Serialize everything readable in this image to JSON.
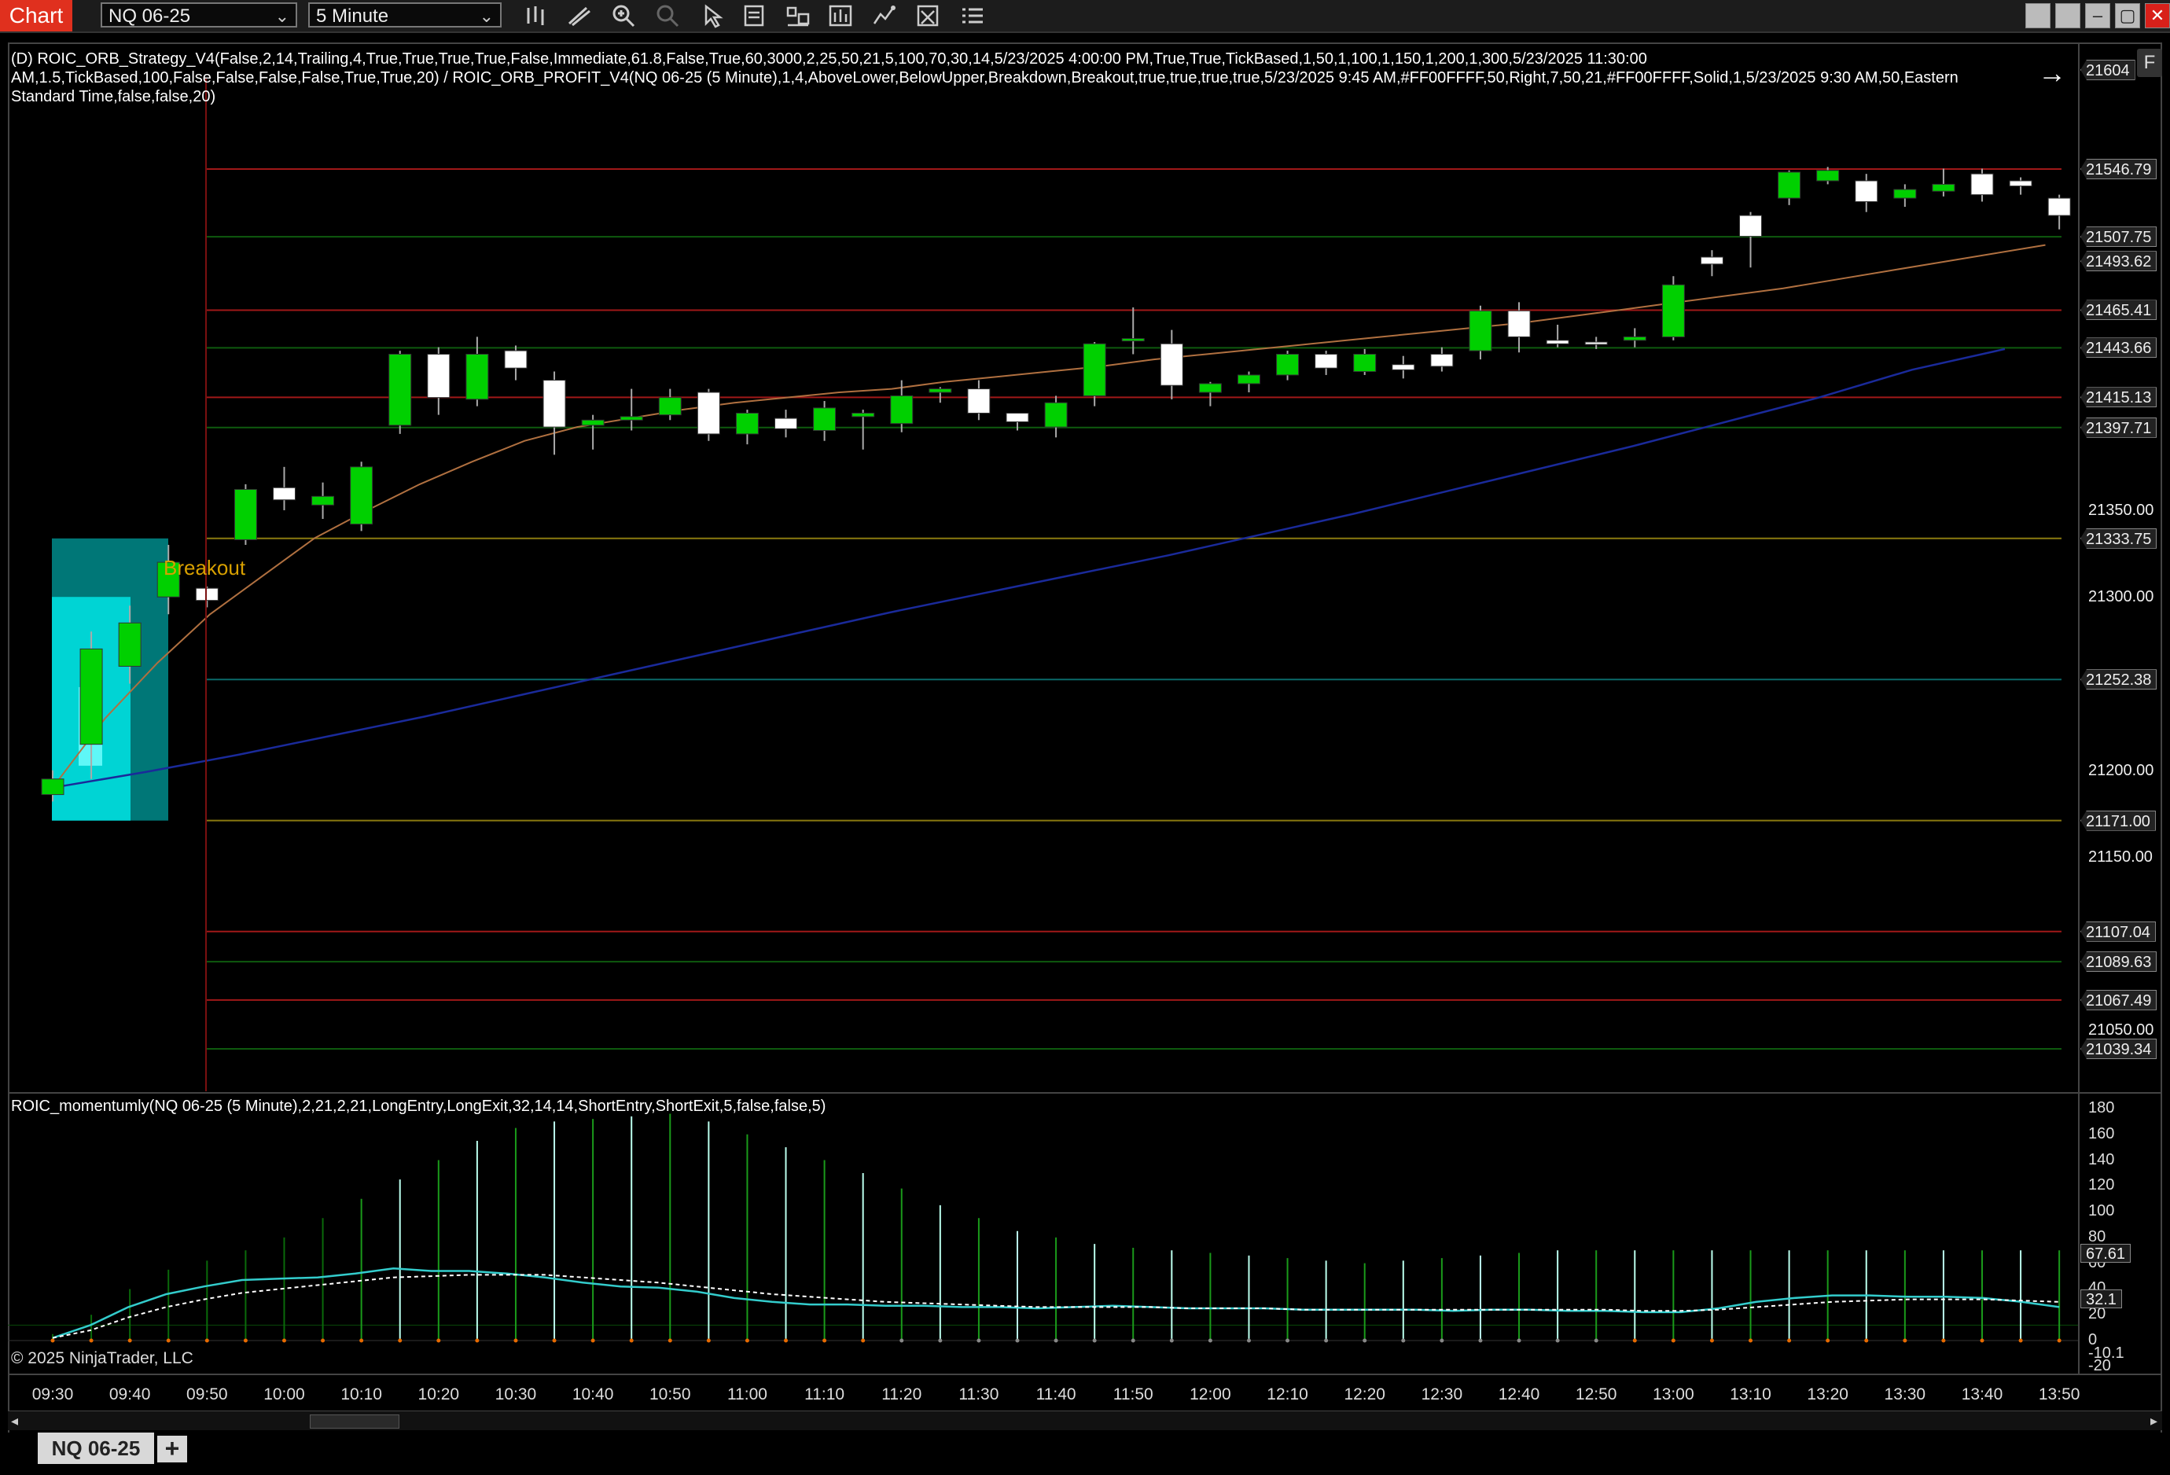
{
  "toolbar": {
    "chart_label": "Chart",
    "instrument": "NQ 06-25",
    "interval": "5 Minute",
    "icons": [
      "bars-type-icon",
      "draw-tool-icon",
      "zoom-in-icon",
      "zoom-out-icon",
      "pointer-icon",
      "data-box-icon",
      "strategies-icon",
      "indicators-icon",
      "chart-trader-icon",
      "templates-icon",
      "properties-icon"
    ],
    "window_buttons": [
      "minimize-icon",
      "restore-icon",
      "close-icon"
    ]
  },
  "panel_top": {
    "strategy_signature_line1": "(D) ROIC_ORB_Strategy_V4(False,2,14,Trailing,4,True,True,True,True,False,Immediate,61.8,False,True,60,3000,2,25,50,21,5,100,70,30,14,5/23/2025 4:00:00 PM,True,True,TickBased,1,50,1,100,1,150,1,200,1,300,5/23/2025 11:30:00",
    "strategy_signature_line2": "AM,1.5,TickBased,100,False,False,False,False,True,True,20) / ROIC_ORB_PROFIT_V4(NQ 06-25 (5 Minute),1,4,AboveLower,BelowUpper,Breakdown,Breakout,true,true,true,true,5/23/2025 9:45 AM,#FF00FFFF,50,Right,7,50,21,#FF00FFFF,Solid,1,5/23/2025 9:30 AM,50,Eastern",
    "strategy_signature_line3": "Standard Time,false,false,20)",
    "breakout_label": "Breakout",
    "f_badge": "F"
  },
  "price_scale": {
    "tags": [
      "21604",
      "21546.79",
      "21507.75",
      "21493.62",
      "21465.41",
      "21443.66",
      "21415.13",
      "21397.71",
      "21333.75",
      "21252.38",
      "21171.00",
      "21107.04",
      "21089.63",
      "21067.49",
      "21039.34"
    ],
    "plain_labels": [
      "21350.00",
      "21300.00",
      "21200.00",
      "21150.00",
      "21050.00"
    ]
  },
  "indicator": {
    "signature": "ROIC_momentumly(NQ 06-25 (5 Minute),2,21,2,21,LongEntry,LongExit,32,14,14,ShortEntry,ShortExit,5,false,false,5)",
    "scale_labels": [
      "180",
      "160",
      "140",
      "120",
      "100",
      "80",
      "60",
      "40",
      "20",
      "0",
      "-10.1",
      "-20"
    ],
    "value_tags": [
      "67.61",
      "32.1"
    ]
  },
  "time_axis": [
    "09:30",
    "09:40",
    "09:50",
    "10:00",
    "10:10",
    "10:20",
    "10:30",
    "10:40",
    "10:50",
    "11:00",
    "11:10",
    "11:20",
    "11:30",
    "11:40",
    "11:50",
    "12:00",
    "12:10",
    "12:20",
    "12:30",
    "12:40",
    "12:50",
    "13:00",
    "13:10",
    "13:20",
    "13:30",
    "13:40",
    "13:50"
  ],
  "copyright": "© 2025 NinjaTrader, LLC",
  "tabs": {
    "active": "NQ 06-25",
    "add": "+"
  },
  "colors": {
    "up": "#00d000",
    "down": "#ffffff",
    "ema_fast": "#b07040",
    "ema_slow": "#1a2a9a",
    "orb_box": "#00d8d8",
    "red_line": "#a01818",
    "green_line": "#0e5a0e",
    "yellow_line": "#8a7a10",
    "cyan_line": "#0a6a6a"
  },
  "chart_data": {
    "type": "candlestick",
    "symbol": "NQ 06-25",
    "interval": "5 Minute",
    "x": [
      "09:30",
      "09:35",
      "09:40",
      "09:45",
      "09:50",
      "09:55",
      "10:00",
      "10:05",
      "10:10",
      "10:15",
      "10:20",
      "10:25",
      "10:30",
      "10:35",
      "10:40",
      "10:45",
      "10:50",
      "10:55",
      "11:00",
      "11:05",
      "11:10",
      "11:15",
      "11:20",
      "11:25",
      "11:30",
      "11:35",
      "11:40",
      "11:45",
      "11:50",
      "11:55",
      "12:00",
      "12:05",
      "12:10",
      "12:15",
      "12:20",
      "12:25",
      "12:30",
      "12:35",
      "12:40",
      "12:45",
      "12:50",
      "12:55",
      "13:00",
      "13:05",
      "13:10",
      "13:15",
      "13:20",
      "13:25",
      "13:30",
      "13:35",
      "13:40",
      "13:45",
      "13:50"
    ],
    "ohlc": [
      [
        21186,
        21200,
        21182,
        21195
      ],
      [
        21215,
        21280,
        21195,
        21270
      ],
      [
        21260,
        21295,
        21250,
        21285
      ],
      [
        21300,
        21330,
        21290,
        21320
      ],
      [
        21305,
        21306,
        21294,
        21298
      ],
      [
        21333,
        21365,
        21330,
        21362
      ],
      [
        21363,
        21375,
        21350,
        21356
      ],
      [
        21353,
        21366,
        21345,
        21358
      ],
      [
        21342,
        21378,
        21338,
        21375
      ],
      [
        21399,
        21442,
        21394,
        21440
      ],
      [
        21440,
        21444,
        21405,
        21415
      ],
      [
        21414,
        21450,
        21410,
        21440
      ],
      [
        21442,
        21445,
        21425,
        21432
      ],
      [
        21425,
        21430,
        21382,
        21398
      ],
      [
        21399,
        21405,
        21385,
        21402
      ],
      [
        21402,
        21420,
        21396,
        21404
      ],
      [
        21405,
        21420,
        21402,
        21415
      ],
      [
        21418,
        21420,
        21390,
        21394
      ],
      [
        21394,
        21408,
        21388,
        21406
      ],
      [
        21403,
        21408,
        21392,
        21397
      ],
      [
        21396,
        21413,
        21390,
        21409
      ],
      [
        21404,
        21408,
        21385,
        21406
      ],
      [
        21400,
        21425,
        21395,
        21416
      ],
      [
        21418,
        21421,
        21412,
        21420
      ],
      [
        21420,
        21425,
        21402,
        21406
      ],
      [
        21406,
        21405,
        21396,
        21401
      ],
      [
        21398,
        21416,
        21392,
        21412
      ],
      [
        21416,
        21447,
        21410,
        21446
      ],
      [
        21448,
        21467,
        21440,
        21449
      ],
      [
        21446,
        21454,
        21414,
        21422
      ],
      [
        21418,
        21424,
        21410,
        21423
      ],
      [
        21423,
        21430,
        21418,
        21428
      ],
      [
        21428,
        21442,
        21425,
        21440
      ],
      [
        21440,
        21442,
        21428,
        21432
      ],
      [
        21430,
        21443,
        21428,
        21440
      ],
      [
        21434,
        21439,
        21426,
        21431
      ],
      [
        21440,
        21444,
        21430,
        21433
      ],
      [
        21442,
        21468,
        21437,
        21465
      ],
      [
        21465,
        21470,
        21441,
        21450
      ],
      [
        21448,
        21457,
        21444,
        21446
      ],
      [
        21447,
        21450,
        21443,
        21446
      ],
      [
        21448,
        21455,
        21444,
        21450
      ],
      [
        21450,
        21485,
        21448,
        21480
      ],
      [
        21496,
        21500,
        21485,
        21492
      ],
      [
        21520,
        21522,
        21490,
        21508
      ],
      [
        21530,
        21546,
        21526,
        21545
      ],
      [
        21540,
        21548,
        21538,
        21546
      ],
      [
        21540,
        21544,
        21522,
        21528
      ],
      [
        21530,
        21538,
        21525,
        21535
      ],
      [
        21534,
        21547,
        21531,
        21538
      ],
      [
        21544,
        21547,
        21528,
        21532
      ],
      [
        21540,
        21542,
        21532,
        21537
      ],
      [
        21530,
        21532,
        21512,
        21520
      ]
    ],
    "ema_fast": [
      21190,
      21230,
      21262,
      21290,
      21312,
      21334,
      21350,
      21365,
      21378,
      21390,
      21398,
      21403,
      21408,
      21412,
      21415,
      21418,
      21420,
      21424,
      21427,
      21430,
      21433,
      21437,
      21440,
      21443,
      21446,
      21449,
      21452,
      21455,
      21458,
      21462,
      21466,
      21470,
      21474,
      21478,
      21483,
      21488,
      21493,
      21498,
      21503
    ],
    "ema_slow": [
      21190,
      21199,
      21209,
      21220,
      21231,
      21243,
      21255,
      21267,
      21279,
      21291,
      21302,
      21313,
      21324,
      21336,
      21348,
      21361,
      21374,
      21387,
      21401,
      21415,
      21431,
      21443
    ],
    "levels": [
      {
        "value": 21546.79,
        "color": "red"
      },
      {
        "value": 21507.75,
        "color": "green"
      },
      {
        "value": 21465.41,
        "color": "red"
      },
      {
        "value": 21443.66,
        "color": "green"
      },
      {
        "value": 21415.13,
        "color": "red"
      },
      {
        "value": 21397.71,
        "color": "green"
      },
      {
        "value": 21333.75,
        "color": "yellow"
      },
      {
        "value": 21252.38,
        "color": "cyan"
      },
      {
        "value": 21171.0,
        "color": "yellow"
      },
      {
        "value": 21107.04,
        "color": "red"
      },
      {
        "value": 21089.63,
        "color": "green"
      },
      {
        "value": 21067.49,
        "color": "red"
      },
      {
        "value": 21039.34,
        "color": "green"
      }
    ],
    "orb_box": {
      "high": 21333.75,
      "low": 21171.0
    },
    "ylim": [
      21010,
      21625
    ],
    "momentum": {
      "ylim": [
        -22,
        185
      ],
      "bars": [
        5,
        20,
        40,
        55,
        62,
        70,
        80,
        95,
        110,
        125,
        140,
        155,
        165,
        170,
        172,
        174,
        176,
        170,
        160,
        150,
        140,
        130,
        118,
        105,
        95,
        85,
        80,
        75,
        72,
        70,
        68,
        66,
        64,
        62,
        60,
        62,
        64,
        66,
        68,
        70,
        70,
        70,
        70,
        70,
        70,
        70,
        70,
        70,
        70,
        70,
        70,
        70,
        70
      ],
      "line": [
        2,
        12,
        26,
        36,
        42,
        47,
        48,
        49,
        52,
        56,
        54,
        54,
        52,
        49,
        45,
        42,
        41,
        38,
        33,
        30,
        28,
        28,
        27,
        27,
        26,
        26,
        25,
        26,
        27,
        26,
        25,
        25,
        25,
        24,
        24,
        24,
        24,
        23,
        24,
        24,
        23,
        23,
        22,
        22,
        25,
        30,
        33,
        35,
        35,
        34,
        34,
        33,
        30,
        26
      ],
      "signal": [
        2,
        8,
        18,
        26,
        32,
        37,
        40,
        43,
        46,
        49,
        50,
        51,
        51,
        51,
        49,
        47,
        45,
        42,
        39,
        36,
        34,
        32,
        30,
        29,
        28,
        27,
        26,
        26,
        26,
        26,
        25,
        25,
        25,
        24,
        24,
        24,
        24,
        24,
        24,
        24,
        24,
        24,
        23,
        23,
        24,
        26,
        28,
        30,
        31,
        32,
        32,
        32,
        31,
        30
      ]
    }
  }
}
